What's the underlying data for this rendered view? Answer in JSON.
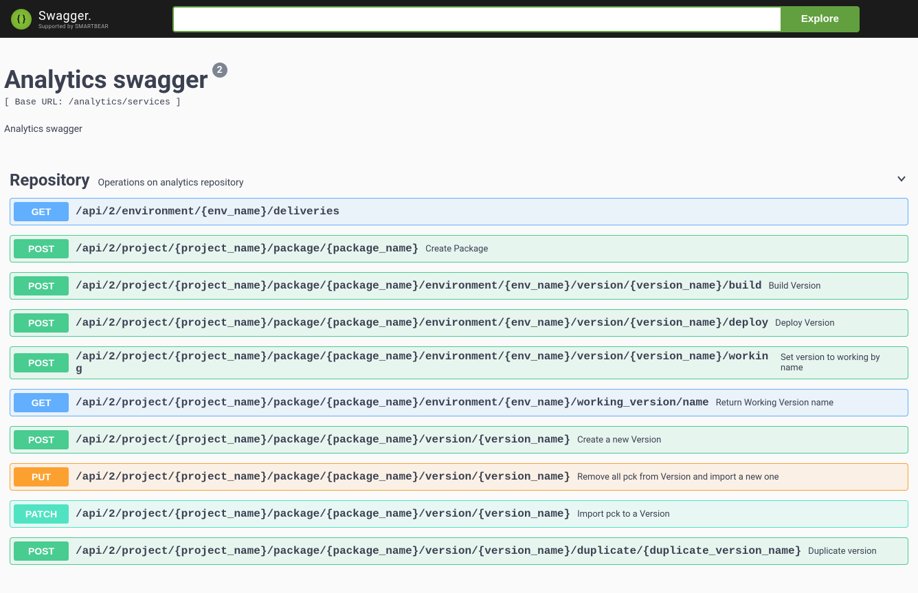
{
  "header": {
    "brand": "Swagger.",
    "subbrand": "Supported by SMARTBEAR",
    "search_value": "",
    "explore_label": "Explore"
  },
  "api": {
    "title": "Analytics swagger",
    "version": "2",
    "baseurl": "[ Base URL: /analytics/services ]",
    "description": "Analytics swagger"
  },
  "tag": {
    "name": "Repository",
    "description": "Operations on analytics repository"
  },
  "ops": [
    {
      "method": "GET",
      "path": "/api/2/environment/{env_name}/deliveries",
      "summary": ""
    },
    {
      "method": "POST",
      "path": "/api/2/project/{project_name}/package/{package_name}",
      "summary": "Create Package"
    },
    {
      "method": "POST",
      "path": "/api/2/project/{project_name}/package/{package_name}/environment/{env_name}/version/{version_name}/build",
      "summary": "Build Version"
    },
    {
      "method": "POST",
      "path": "/api/2/project/{project_name}/package/{package_name}/environment/{env_name}/version/{version_name}/deploy",
      "summary": "Deploy Version"
    },
    {
      "method": "POST",
      "path": "/api/2/project/{project_name}/package/{package_name}/environment/{env_name}/version/{version_name}/working",
      "summary": "Set version to working by name"
    },
    {
      "method": "GET",
      "path": "/api/2/project/{project_name}/package/{package_name}/environment/{env_name}/working_version/name",
      "summary": "Return Working Version name"
    },
    {
      "method": "POST",
      "path": "/api/2/project/{project_name}/package/{package_name}/version/{version_name}",
      "summary": "Create a new Version"
    },
    {
      "method": "PUT",
      "path": "/api/2/project/{project_name}/package/{package_name}/version/{version_name}",
      "summary": "Remove all pck from Version and import a new one"
    },
    {
      "method": "PATCH",
      "path": "/api/2/project/{project_name}/package/{package_name}/version/{version_name}",
      "summary": "Import pck to a Version"
    },
    {
      "method": "POST",
      "path": "/api/2/project/{project_name}/package/{package_name}/version/{version_name}/duplicate/{duplicate_version_name}",
      "summary": "Duplicate version"
    }
  ]
}
